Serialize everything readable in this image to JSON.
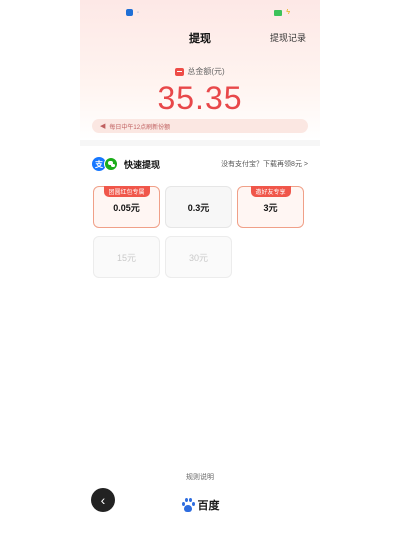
{
  "header": {
    "title": "提现",
    "record_link": "提现记录"
  },
  "balance": {
    "label": "总金额(元)",
    "amount": "35.35"
  },
  "notice": {
    "text": "每日中午12点刷新份额"
  },
  "fast_withdraw": {
    "label": "快速提现",
    "download_tip": "没有支付宝？下载再领8元 >"
  },
  "options": [
    {
      "label": "0.05元",
      "badge": "团圆红包专属",
      "highlighted": true,
      "disabled": false
    },
    {
      "label": "0.3元",
      "badge": "",
      "highlighted": false,
      "disabled": false
    },
    {
      "label": "3元",
      "badge": "邀好友专享",
      "highlighted": true,
      "disabled": false
    },
    {
      "label": "15元",
      "badge": "",
      "highlighted": false,
      "disabled": true
    },
    {
      "label": "30元",
      "badge": "",
      "highlighted": false,
      "disabled": true
    }
  ],
  "footer": {
    "rules_link": "规则说明",
    "brand": "百度"
  },
  "icons": {
    "alipay": "alipay-icon",
    "wechat": "wechat-icon",
    "back": "back-arrow-icon",
    "brand": "baidu-paw-icon"
  },
  "colors": {
    "accent": "#e8484a",
    "badge": "#f0564a",
    "alipay": "#1677ff",
    "wechat": "#1aad19"
  }
}
